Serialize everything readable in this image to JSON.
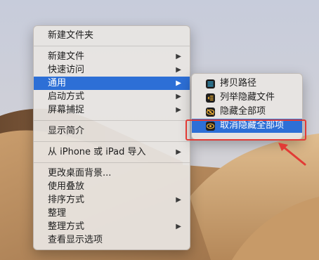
{
  "main_menu": {
    "items": [
      {
        "label": "新建文件夹",
        "has_submenu": false
      },
      {
        "label": "新建文件",
        "has_submenu": true
      },
      {
        "label": "快速访问",
        "has_submenu": true
      },
      {
        "label": "通用",
        "has_submenu": true,
        "active": true
      },
      {
        "label": "启动方式",
        "has_submenu": true
      },
      {
        "label": "屏幕捕捉",
        "has_submenu": true
      },
      {
        "label": "显示简介",
        "has_submenu": false
      },
      {
        "label": "从 iPhone 或 iPad 导入",
        "has_submenu": true
      },
      {
        "label": "更改桌面背景...",
        "has_submenu": false
      },
      {
        "label": "使用叠放",
        "has_submenu": false
      },
      {
        "label": "排序方式",
        "has_submenu": true
      },
      {
        "label": "整理",
        "has_submenu": false
      },
      {
        "label": "整理方式",
        "has_submenu": true
      },
      {
        "label": "查看显示选项",
        "has_submenu": false
      }
    ],
    "submenu_arrow": "▶"
  },
  "sub_menu": {
    "items": [
      {
        "label": "拷贝路径",
        "icon": "copy-path-icon"
      },
      {
        "label": "列举隐藏文件",
        "icon": "list-hidden-icon"
      },
      {
        "label": "隐藏全部项",
        "icon": "hide-all-icon"
      },
      {
        "label": "取消隐藏全部项",
        "icon": "unhide-all-icon",
        "active": true
      }
    ]
  },
  "colors": {
    "accent": "#2d6fd6",
    "annotation": "#e23b35",
    "icon_bg": "#1f1f1f",
    "icon_yellow": "#f2b233"
  }
}
